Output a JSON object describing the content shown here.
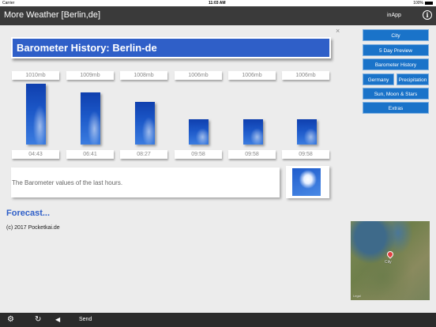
{
  "status_bar": {
    "carrier": "Carrier",
    "time": "11:03 AM",
    "battery": "100%"
  },
  "nav": {
    "title": "More Weather [Berlin,de]",
    "inapp": "inApp",
    "info_icon": "info-icon"
  },
  "close_icon": "×",
  "heading": "Barometer History: Berlin-de",
  "history": [
    {
      "pressure": "1010mb",
      "time": "04:43",
      "value": 1010
    },
    {
      "pressure": "1009mb",
      "time": "06:41",
      "value": 1009
    },
    {
      "pressure": "1008mb",
      "time": "08:27",
      "value": 1008
    },
    {
      "pressure": "1006mb",
      "time": "09:58",
      "value": 1006
    },
    {
      "pressure": "1006mb",
      "time": "09:58",
      "value": 1006
    },
    {
      "pressure": "1006mb",
      "time": "09:58",
      "value": 1006
    }
  ],
  "description": "The Barometer values of the last hours.",
  "forecast_link": "Forecast...",
  "copyright": "(c) 2017 Pocketkai.de",
  "side_menu": {
    "city": "City",
    "five_day": "5 Day Preview",
    "barometer": "Barometer History",
    "germany": "Germany",
    "precipitation": "Precipitation",
    "sun_moon": "Sun, Moon & Stars",
    "extras": "Extras"
  },
  "map": {
    "pin_label": "City",
    "legal": "Legal"
  },
  "bottom_bar": {
    "send": "Send",
    "back_glyph": "◀",
    "refresh_glyph": "↻",
    "share_glyph": "⚙"
  }
}
